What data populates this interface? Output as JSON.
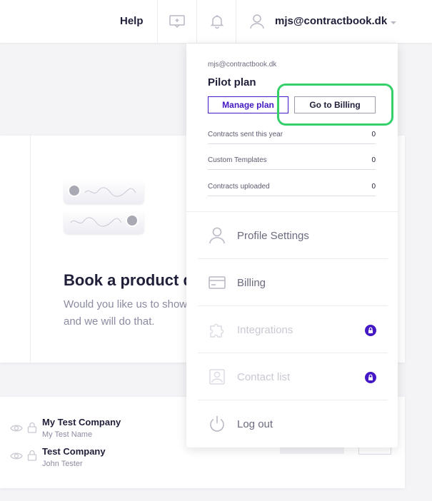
{
  "header": {
    "help_label": "Help",
    "user_email": "mjs@contractbook.dk",
    "icons": [
      "feedback-icon",
      "bell-icon",
      "user-icon",
      "chevron-down-icon"
    ]
  },
  "background": {
    "demo_card": {
      "title": "Book a product d",
      "subtitle_line1": "Would you like us to show",
      "subtitle_line2": "and we will do that."
    },
    "companies": [
      {
        "name": "My Test Company",
        "person": "My Test Name"
      },
      {
        "name": "Test Company",
        "person": "John Tester"
      }
    ]
  },
  "dropdown": {
    "email": "mjs@contractbook.dk",
    "plan": "Pilot plan",
    "manage_plan_label": "Manage plan",
    "go_to_billing_label": "Go to Billing",
    "stats": [
      {
        "label": "Contracts sent this year",
        "value": "0"
      },
      {
        "label": "Custom Templates",
        "value": "0"
      },
      {
        "label": "Contracts uploaded",
        "value": "0"
      }
    ],
    "menu": [
      {
        "label": "Profile Settings",
        "icon": "person-icon",
        "disabled": false
      },
      {
        "label": "Billing",
        "icon": "credit-card-icon",
        "disabled": false
      },
      {
        "label": "Integrations",
        "icon": "puzzle-icon",
        "disabled": true,
        "locked": true
      },
      {
        "label": "Contact list",
        "icon": "contact-card-icon",
        "disabled": true,
        "locked": true
      },
      {
        "label": "Log out",
        "icon": "power-icon",
        "disabled": false
      }
    ]
  },
  "colors": {
    "accent": "#4418c4",
    "highlight": "#34d06a",
    "text_dark": "#1f1f3a",
    "text_muted": "#8b8ba1"
  }
}
